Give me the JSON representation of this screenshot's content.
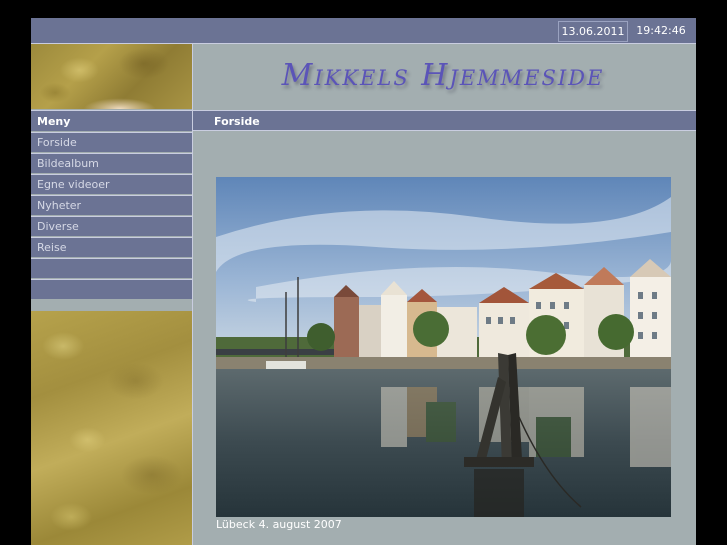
{
  "topbar": {
    "date": "13.06.2011",
    "time": "19:42:46"
  },
  "banner": {
    "title": "Mikkels Hjemmeside"
  },
  "menu": {
    "header": "Meny",
    "items": [
      {
        "label": "Forside"
      },
      {
        "label": "Bildealbum"
      },
      {
        "label": "Egne videoer"
      },
      {
        "label": "Nyheter"
      },
      {
        "label": "Diverse"
      },
      {
        "label": "Reise"
      },
      {
        "label": ""
      },
      {
        "label": ""
      }
    ]
  },
  "content": {
    "page_title": "Forside",
    "caption": "Lübeck 4. august 2007"
  },
  "colors": {
    "bar": "#6b7394",
    "background": "#a3aeb0",
    "title": "#5b54b8"
  }
}
